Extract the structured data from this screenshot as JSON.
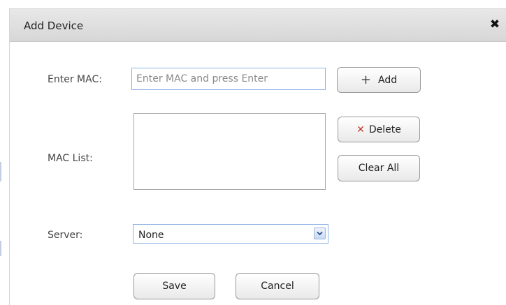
{
  "dialog": {
    "title": "Add Device",
    "close_label": "✖"
  },
  "form": {
    "mac_label": "Enter MAC:",
    "mac_value": "",
    "mac_placeholder": "Enter MAC and press Enter",
    "add_label": "Add",
    "list_label": "MAC List:",
    "mac_list_items": [],
    "delete_label": "Delete",
    "clear_all_label": "Clear All",
    "server_label": "Server:",
    "server_selected": "None",
    "save_label": "Save",
    "cancel_label": "Cancel"
  },
  "icons": {
    "add": "plus-icon",
    "delete": "x-icon",
    "close": "close-icon",
    "select_arrow": "chevron-down-icon"
  },
  "colors": {
    "input_border": "#8db2e3",
    "delete_icon": "#c0392b",
    "titlebar": "#dcdcdc"
  }
}
